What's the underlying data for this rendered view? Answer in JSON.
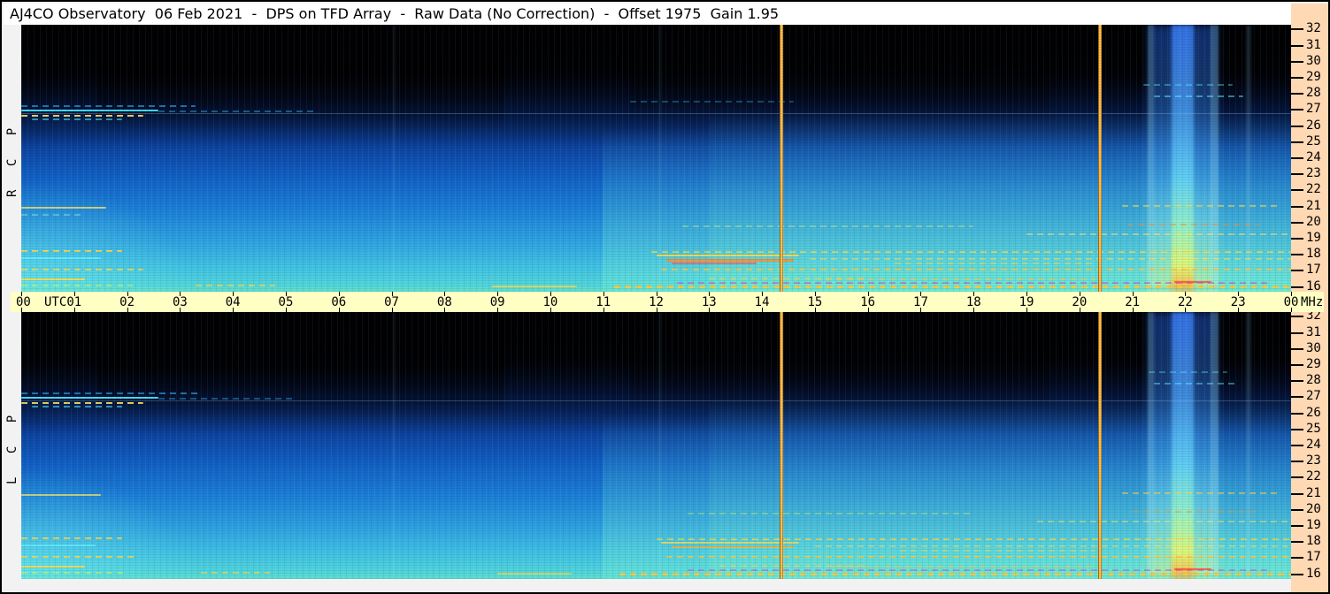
{
  "title_bar": {
    "text": "AJ4CO Observatory  06 Feb 2021  -  DPS on TFD Array  -  Raw Data (No Correction)  -  Offset 1975  Gain 1.95"
  },
  "panels": [
    {
      "id": "rcp",
      "label": "R C P"
    },
    {
      "id": "lcp",
      "label": "L C P"
    }
  ],
  "time_axis": {
    "start_label": "00",
    "utc_suffix": "UTC",
    "hour_labels": [
      "01",
      "02",
      "03",
      "04",
      "05",
      "06",
      "07",
      "08",
      "09",
      "10",
      "11",
      "12",
      "13",
      "14",
      "15",
      "16",
      "17",
      "18",
      "19",
      "20",
      "21",
      "22",
      "23"
    ],
    "end_label": "00",
    "unit_suffix": "MHz"
  },
  "freq_axis": {
    "labels": [
      "32",
      "31",
      "30",
      "29",
      "28",
      "27",
      "26",
      "25",
      "24",
      "23",
      "22",
      "21",
      "20",
      "19",
      "18",
      "17",
      "16"
    ],
    "unit": "MHz"
  },
  "colors": {
    "window_bg": "#f2f2f2",
    "titlebar_bg": "#ffffff",
    "time_axis_bg": "#ffffc4",
    "freq_scale_bg": "#ffd9b4",
    "border": "#000000",
    "marker_line": "#f5a623"
  },
  "chart_data": {
    "type": "heatmap",
    "subtype": "radio-spectrogram-dual-polarization",
    "title": "AJ4CO Observatory 06 Feb 2021 - DPS on TFD Array - Raw Data (No Correction) - Offset 1975 Gain 1.95",
    "x": {
      "label": "UTC",
      "unit": "hours",
      "min": 0,
      "max": 24,
      "tick_step": 1
    },
    "y": {
      "label": "MHz",
      "unit": "MHz",
      "min": 16,
      "max": 32,
      "tick_step": 1,
      "top_edge_mhz": 32.3,
      "bottom_edge_mhz": 15.7
    },
    "panel_names": [
      "RCP",
      "LCP"
    ],
    "intensity_description": "black at high frequencies (28-32 MHz) grading through blue to bright cyan-green at 16 MHz; low-frequency half brightens after ~11 UTC",
    "marker_lines_utc": [
      14.37,
      20.38
    ],
    "emission_event": {
      "utc_center": 21.95,
      "utc_span": [
        21.3,
        22.6
      ],
      "description": "broadband vertical burst spanning 16-32 MHz, brightening to yellow-orange at low frequencies"
    },
    "event_bands": [
      {
        "t": 21.95,
        "w": 1.3,
        "type": "soft",
        "op": 1
      },
      {
        "t": 21.95,
        "w": 0.42,
        "type": "core",
        "op": 1
      },
      {
        "t": 21.35,
        "w": 0.12,
        "type": "thin",
        "op": 0.55
      },
      {
        "t": 22.55,
        "w": 0.16,
        "type": "thin",
        "op": 0.6
      },
      {
        "t": 23.2,
        "w": 0.1,
        "type": "thin",
        "op": 0.3
      },
      {
        "t": 7.05,
        "w": 0.06,
        "type": "thin",
        "op": 0.18
      },
      {
        "t": 12.08,
        "w": 0.06,
        "type": "thin",
        "op": 0.15
      }
    ],
    "streak_format": [
      "utc_start",
      "utc_end",
      "mhz",
      "color",
      "opacity",
      "thickness_px",
      "dashed"
    ],
    "streaks_rcp": [
      [
        0,
        2.6,
        27.0,
        "#45e8ff",
        0.95,
        2,
        0
      ],
      [
        0,
        2.3,
        26.7,
        "#ffe565",
        0.9,
        2,
        1
      ],
      [
        0,
        3.3,
        27.3,
        "#2fb4ff",
        0.6,
        2,
        1
      ],
      [
        0.2,
        1.9,
        26.45,
        "#45e8ff",
        0.6,
        2,
        1
      ],
      [
        2.6,
        5.6,
        26.95,
        "#2fb4ff",
        0.45,
        2,
        1
      ],
      [
        0,
        24,
        26.8,
        "#aadcff",
        0.3,
        1,
        0
      ],
      [
        0,
        1.6,
        21.0,
        "#ffe565",
        0.75,
        2,
        0
      ],
      [
        0,
        1.2,
        20.55,
        "#7df2d8",
        0.5,
        2,
        1
      ],
      [
        0,
        1.9,
        18.3,
        "#ffd947",
        0.85,
        2,
        1
      ],
      [
        0,
        1.5,
        17.85,
        "#62f0ff",
        0.8,
        2,
        0
      ],
      [
        0,
        2.3,
        17.15,
        "#ffd947",
        0.8,
        2,
        1
      ],
      [
        0,
        1.2,
        16.5,
        "#ffd947",
        0.9,
        2,
        0
      ],
      [
        0,
        2.1,
        16.15,
        "#b8f27a",
        0.75,
        2,
        1
      ],
      [
        3.3,
        4.8,
        16.15,
        "#ffd947",
        0.7,
        2,
        1
      ],
      [
        8.9,
        10.5,
        16.1,
        "#ffd947",
        0.8,
        2,
        0
      ],
      [
        0,
        24,
        16.0,
        "#62e2cc",
        0.45,
        3,
        0
      ],
      [
        11.2,
        24,
        16.1,
        "#ffc63e",
        0.85,
        3,
        1
      ],
      [
        12.4,
        23.6,
        16.3,
        "#cc4ecc",
        0.55,
        2,
        1
      ],
      [
        21.8,
        22.5,
        16.35,
        "#ff4545",
        0.8,
        2,
        0
      ],
      [
        11.9,
        24,
        18.25,
        "#ffd947",
        0.7,
        2,
        1
      ],
      [
        12,
        14.7,
        18.0,
        "#ffd947",
        0.85,
        2,
        0
      ],
      [
        12.2,
        14.6,
        17.75,
        "#ff8c2e",
        0.9,
        3,
        0
      ],
      [
        12.3,
        13.9,
        17.5,
        "#ff5a4a",
        0.75,
        2,
        0
      ],
      [
        12.1,
        24,
        17.15,
        "#ffc63e",
        0.8,
        2,
        1
      ],
      [
        13,
        16,
        16.6,
        "#ffd947",
        0.55,
        2,
        1
      ],
      [
        14.9,
        24,
        17.8,
        "#ffe565",
        0.5,
        2,
        1
      ],
      [
        12.5,
        18,
        19.85,
        "#b8f27a",
        0.45,
        2,
        1
      ],
      [
        19,
        24,
        19.35,
        "#ffe565",
        0.5,
        2,
        1
      ],
      [
        20.8,
        23.8,
        21.1,
        "#ffd947",
        0.6,
        2,
        1
      ],
      [
        20.9,
        23.4,
        19.95,
        "#ff8c2e",
        0.5,
        2,
        1
      ],
      [
        21.4,
        23.1,
        27.9,
        "#62f0ff",
        0.5,
        2,
        1
      ],
      [
        21.2,
        22.9,
        28.6,
        "#62f0ff",
        0.4,
        2,
        1
      ],
      [
        11.5,
        14.6,
        27.6,
        "#4ac8ff",
        0.3,
        2,
        1
      ],
      [
        16.5,
        20.3,
        17.5,
        "#ffd947",
        0.45,
        2,
        1
      ],
      [
        15.2,
        20.3,
        16.55,
        "#ffc63e",
        0.5,
        2,
        1
      ]
    ],
    "streaks_lcp": [
      [
        0,
        2.6,
        27.0,
        "#45e8ff",
        0.95,
        2,
        0
      ],
      [
        0,
        2.3,
        26.7,
        "#ffe565",
        0.9,
        2,
        1
      ],
      [
        0,
        3.4,
        27.3,
        "#2fb4ff",
        0.6,
        2,
        1
      ],
      [
        0.2,
        1.9,
        26.45,
        "#45e8ff",
        0.6,
        2,
        1
      ],
      [
        2.6,
        5.2,
        26.95,
        "#2fb4ff",
        0.4,
        2,
        1
      ],
      [
        0,
        24,
        26.8,
        "#aadcff",
        0.28,
        1,
        0
      ],
      [
        0,
        1.5,
        21.0,
        "#ffe565",
        0.7,
        2,
        0
      ],
      [
        0,
        1.9,
        18.3,
        "#ffd947",
        0.8,
        2,
        1
      ],
      [
        0,
        1.4,
        17.85,
        "#62f0ff",
        0.75,
        2,
        0
      ],
      [
        0,
        2.2,
        17.15,
        "#ffd947",
        0.75,
        2,
        1
      ],
      [
        0,
        1.2,
        16.5,
        "#ffd947",
        0.85,
        2,
        0
      ],
      [
        0,
        2.0,
        16.15,
        "#b8f27a",
        0.7,
        2,
        1
      ],
      [
        3.4,
        4.7,
        16.15,
        "#ffd947",
        0.6,
        2,
        1
      ],
      [
        9.0,
        10.4,
        16.1,
        "#ffd947",
        0.7,
        2,
        0
      ],
      [
        0,
        24,
        16.0,
        "#62e2cc",
        0.45,
        3,
        0
      ],
      [
        11.3,
        24,
        16.1,
        "#ffc63e",
        0.85,
        3,
        1
      ],
      [
        12.6,
        23.6,
        16.3,
        "#cc4ecc",
        0.5,
        2,
        1
      ],
      [
        21.8,
        22.5,
        16.35,
        "#ff4545",
        0.8,
        2,
        0
      ],
      [
        12.0,
        24,
        18.25,
        "#ffd947",
        0.65,
        2,
        1
      ],
      [
        12.1,
        14.7,
        18.0,
        "#ffd947",
        0.75,
        2,
        0
      ],
      [
        12.3,
        14.6,
        17.75,
        "#ffb02e",
        0.8,
        2,
        0
      ],
      [
        12.2,
        24,
        17.15,
        "#ffc63e",
        0.75,
        2,
        1
      ],
      [
        13.2,
        16,
        16.6,
        "#ffd947",
        0.5,
        2,
        1
      ],
      [
        15.0,
        24,
        17.8,
        "#ffe565",
        0.45,
        2,
        1
      ],
      [
        12.6,
        18,
        19.85,
        "#b8f27a",
        0.4,
        2,
        1
      ],
      [
        19.2,
        24,
        19.35,
        "#ffe565",
        0.45,
        2,
        1
      ],
      [
        20.8,
        23.8,
        21.1,
        "#ffd947",
        0.55,
        2,
        1
      ],
      [
        21.0,
        23.4,
        19.95,
        "#ff8c2e",
        0.45,
        2,
        1
      ],
      [
        21.4,
        23.0,
        27.9,
        "#62f0ff",
        0.45,
        2,
        1
      ],
      [
        21.3,
        22.8,
        28.6,
        "#62f0ff",
        0.35,
        2,
        1
      ],
      [
        16.6,
        20.3,
        17.5,
        "#ffd947",
        0.4,
        2,
        1
      ],
      [
        15.3,
        20.3,
        16.55,
        "#ffc63e",
        0.45,
        2,
        1
      ]
    ]
  }
}
